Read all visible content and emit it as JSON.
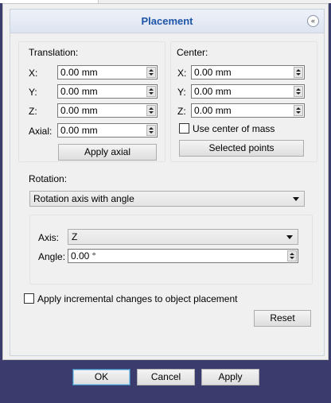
{
  "panel": {
    "title": "Placement",
    "collapse_icon": "double-chevron-up-icon"
  },
  "translation": {
    "heading": "Translation:",
    "x_label": "X:",
    "x_value": "0.00 mm",
    "y_label": "Y:",
    "y_value": "0.00 mm",
    "z_label": "Z:",
    "z_value": "0.00 mm",
    "axial_label": "Axial:",
    "axial_value": "0.00 mm",
    "apply_axial_label": "Apply axial"
  },
  "center": {
    "heading": "Center:",
    "x_label": "X:",
    "x_value": "0.00 mm",
    "y_label": "Y:",
    "y_value": "0.00 mm",
    "z_label": "Z:",
    "z_value": "0.00 mm",
    "use_center_of_mass_label": "Use center of mass",
    "use_center_of_mass_checked": false,
    "selected_points_label": "Selected points"
  },
  "rotation": {
    "heading": "Rotation:",
    "mode_value": "Rotation axis with angle",
    "axis_label": "Axis:",
    "axis_value": "Z",
    "angle_label": "Angle:",
    "angle_value": "0.00 °"
  },
  "incremental": {
    "label": "Apply incremental changes to object placement",
    "checked": false
  },
  "reset_label": "Reset",
  "buttons": {
    "ok_label": "OK",
    "cancel_label": "Cancel",
    "apply_label": "Apply"
  },
  "colors": {
    "title": "#1f55a8",
    "background": "#3b3b6d",
    "panel": "#f0f0f0"
  }
}
